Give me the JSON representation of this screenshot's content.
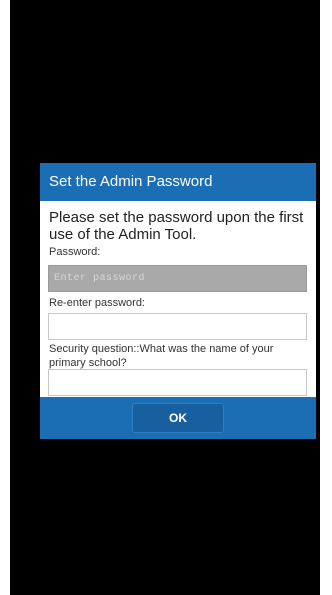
{
  "dialog": {
    "title": "Set the Admin Password",
    "intro": "Please set the password upon the first use of the Admin Tool.",
    "password": {
      "label": "Password:",
      "placeholder": "Enter password"
    },
    "reenter": {
      "label": "Re-enter password:",
      "placeholder": ""
    },
    "security": {
      "label": "Security question::What was the name of your primary school?",
      "placeholder": ""
    },
    "ok_label": "OK"
  },
  "colors": {
    "header": "#1b6db4",
    "background": "#000000",
    "active_input": "#a9a9a9"
  }
}
